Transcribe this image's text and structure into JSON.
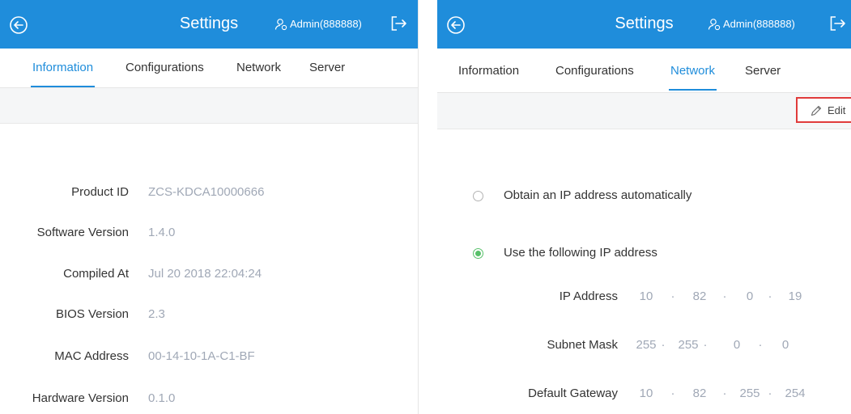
{
  "colors": {
    "header_bg": "#1f8ddb",
    "accent": "#1f8ddb",
    "value_text": "#a0a8b6",
    "radio_selected": "#58c06a",
    "highlight_box": "#e03b3b"
  },
  "left_panel": {
    "header": {
      "title": "Settings",
      "user": "Admin(888888)",
      "back_icon": "back-circle-icon",
      "user_icon": "user-admin-icon",
      "logout_icon": "logout-icon"
    },
    "tabs": [
      "Information",
      "Configurations",
      "Network",
      "Server"
    ],
    "active_tab": "Information",
    "info": [
      {
        "label": "Product ID",
        "value": "ZCS-KDCA10000666"
      },
      {
        "label": "Software Version",
        "value": "1.4.0"
      },
      {
        "label": "Compiled At",
        "value": "Jul 20 2018 22:04:24"
      },
      {
        "label": "BIOS Version",
        "value": "2.3"
      },
      {
        "label": "MAC Address",
        "value": "00-14-10-1A-C1-BF"
      },
      {
        "label": "Hardware Version",
        "value": "0.1.0"
      }
    ]
  },
  "right_panel": {
    "header": {
      "title": "Settings",
      "user": "Admin(888888)",
      "back_icon": "back-circle-icon",
      "user_icon": "user-admin-icon",
      "logout_icon": "logout-icon"
    },
    "tabs": [
      "Information",
      "Configurations",
      "Network",
      "Server"
    ],
    "active_tab": "Network",
    "toolbar": {
      "edit_label": "Edit",
      "edit_icon": "pencil-icon"
    },
    "ip_mode": {
      "auto_label": "Obtain an IP address automatically",
      "manual_label": "Use the following IP address",
      "selected": "manual"
    },
    "ip_fields": [
      {
        "label": "IP Address",
        "octets": [
          "10",
          "82",
          "0",
          "19"
        ]
      },
      {
        "label": "Subnet Mask",
        "octets": [
          "255",
          "255",
          "0",
          "0"
        ]
      },
      {
        "label": "Default Gateway",
        "octets": [
          "10",
          "82",
          "255",
          "254"
        ]
      }
    ],
    "separator": "·"
  }
}
